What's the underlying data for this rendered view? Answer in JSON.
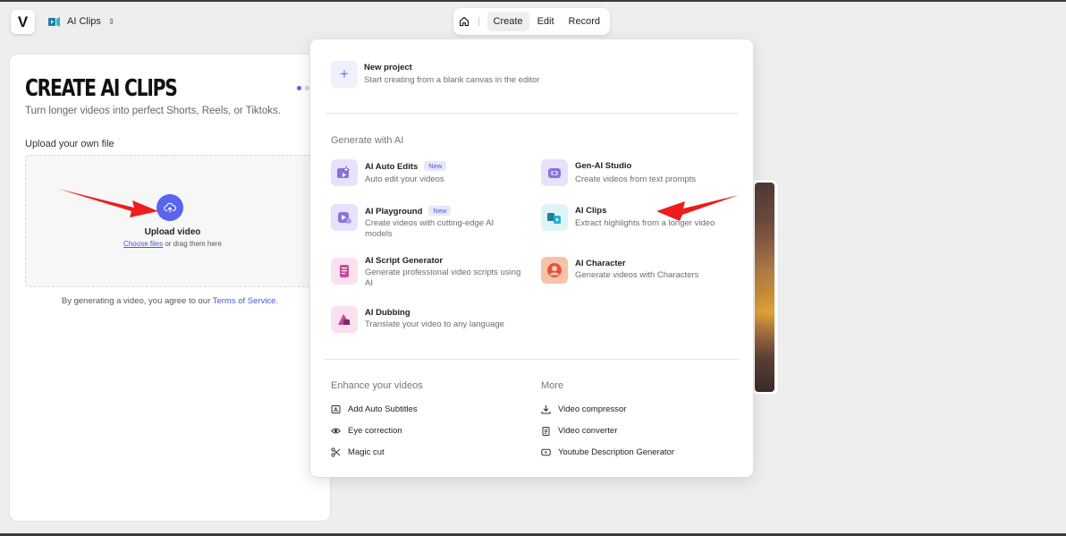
{
  "topbar": {
    "logo": "V",
    "project_name": "AI Clips",
    "modes": {
      "create": "Create",
      "edit": "Edit",
      "record": "Record"
    }
  },
  "card": {
    "title": "CREATE AI CLIPS",
    "subtitle": "Turn longer videos into perfect Shorts, Reels, or Tiktoks.",
    "upload_label": "Upload your own file",
    "upload_title": "Upload video",
    "choose_files": "Choose files",
    "drag_text": " or drag them here",
    "tos_prefix": "By generating a video, you agree to our ",
    "tos_link": "Terms of Service",
    "tos_suffix": "."
  },
  "menu": {
    "new_project": {
      "title": "New project",
      "desc": "Start creating from a blank canvas in the editor"
    },
    "generate_heading": "Generate with AI",
    "badge_new": "New",
    "ai_items": [
      {
        "title": "AI Auto Edits",
        "desc": "Auto edit your videos"
      },
      {
        "title": "Gen-AI Studio",
        "desc": "Create videos from text prompts"
      },
      {
        "title": "AI Playground",
        "desc": "Create videos with cutting-edge AI models"
      },
      {
        "title": "AI Clips",
        "desc": "Extract highlights from a longer video"
      },
      {
        "title": "AI Script Generator",
        "desc": "Generate professional video scripts using AI"
      },
      {
        "title": "AI Character",
        "desc": "Generate videos with Characters"
      },
      {
        "title": "AI Dubbing",
        "desc": "Translate your video to any language"
      }
    ],
    "enhance_heading": "Enhance your videos",
    "enhance_items": [
      "Add Auto Subtitles",
      "Eye correction",
      "Magic cut"
    ],
    "more_heading": "More",
    "more_items": [
      "Video compressor",
      "Video converter",
      "Youtube Description Generator"
    ]
  },
  "colors": {
    "accent": "#5765f0",
    "annotation_arrow": "#ee1c1c"
  }
}
